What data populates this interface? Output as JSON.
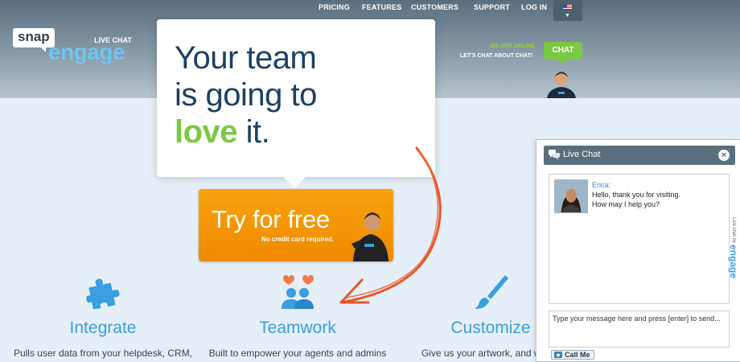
{
  "nav": {
    "items": [
      {
        "label": "PRICING"
      },
      {
        "label": "FEATURES"
      },
      {
        "label": "CUSTOMERS"
      },
      {
        "label": "SUPPORT"
      },
      {
        "label": "LOG IN"
      }
    ]
  },
  "logo": {
    "snap": "snap",
    "engage": "engage",
    "tag": "LIVE CHAT"
  },
  "online": {
    "status": "WE ARE ONLINE",
    "cta_text": "LET'S CHAT ABOUT CHAT!",
    "button": "CHAT"
  },
  "hero": {
    "line1": "Your team",
    "line2": "is going to",
    "love": "love",
    "it": " it.",
    "cta_main": "Try for free",
    "cta_sub": "No credit card required."
  },
  "features": [
    {
      "icon": "puzzle-icon",
      "title": "Integrate",
      "desc": "Pulls user data from your helpdesk, CRM,"
    },
    {
      "icon": "team-hearts-icon",
      "title": "Teamwork",
      "desc": "Built to empower your agents and admins"
    },
    {
      "icon": "paintbrush-icon",
      "title": "Customize",
      "desc": "Give us your artwork, and we'll c"
    }
  ],
  "chat": {
    "title": "Live Chat",
    "agent_name": "Erica:",
    "message_line1": "Hello, thank you for visiting.",
    "message_line2": "How may I help you?",
    "input_placeholder": "Type your message here and press [enter] to send...",
    "call_button": "Call Me",
    "powered_prefix": "Live chat by",
    "powered_brand": "engage"
  },
  "colors": {
    "accent_green": "#7ac943",
    "accent_blue": "#3a9ee0",
    "cta_orange": "#f39a08",
    "heading_navy": "#1e3f63"
  }
}
